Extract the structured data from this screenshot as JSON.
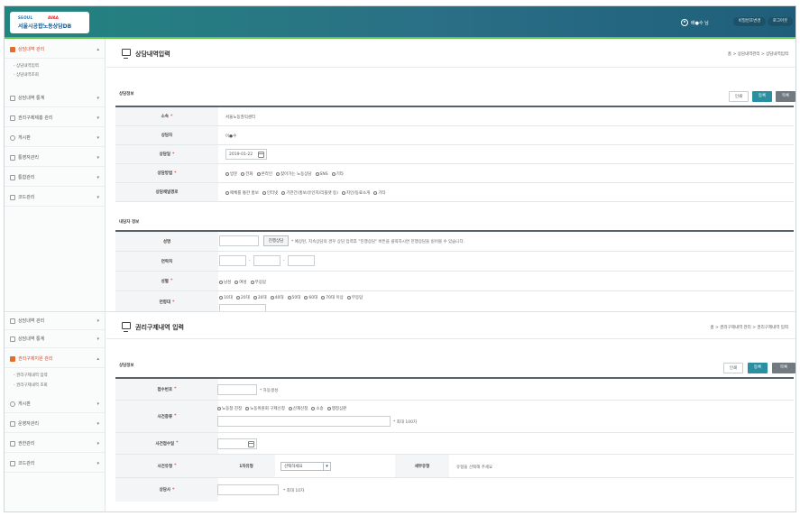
{
  "header": {
    "logo_top": "SEOUL",
    "logo_top_red": "AVAA",
    "logo_main": "서울시공합노동상담DB",
    "user_name": "배●수 님",
    "btn_info": "비밀번호변경",
    "btn_logout": "로그아웃"
  },
  "sidebar_top": {
    "items": [
      {
        "label": "상담내역 관리",
        "active": true
      },
      {
        "label": "상담내역 통계"
      },
      {
        "label": "권리구제제흥 관리"
      },
      {
        "label": "게시판"
      },
      {
        "label": "통영자관리"
      },
      {
        "label": "통합관리"
      },
      {
        "label": "코드관리"
      }
    ],
    "subs": [
      "- 상담내역입력",
      "- 상담내역조회"
    ]
  },
  "sidebar_bottom": {
    "items": [
      {
        "label": "상담내역 관리"
      },
      {
        "label": "상담내역 통계"
      },
      {
        "label": "권리구제지원 관리",
        "active": true
      },
      {
        "label": "게시판"
      },
      {
        "label": "운영자관리"
      },
      {
        "label": "권한관리"
      },
      {
        "label": "코드관리"
      }
    ],
    "subs": [
      "- 권리구제내역 입력",
      "- 권리구제내역 조회"
    ]
  },
  "consult": {
    "title": "상담내역입력",
    "breadcrumb": "홈 > 상담내역관리 > 상담내역입력",
    "section1": "상담정보",
    "buttons": [
      "인쇄",
      "등록",
      "목록"
    ],
    "rows": [
      {
        "label": "소속",
        "req": true,
        "value": "서울노동권익센터"
      },
      {
        "label": "상담자",
        "req": false,
        "value": "이●수"
      },
      {
        "label": "상담일",
        "req": true,
        "value": "2019-01-22"
      },
      {
        "label": "상담방법",
        "req": true,
        "options": [
          "방문",
          "전화",
          "온라인",
          "찾아가는 노동상담",
          "SNS",
          "기타"
        ]
      },
      {
        "label": "상담채널경로",
        "req": false,
        "options": [
          "매체를 통한 홍보",
          "인터넷",
          "기관간(홍보/유인지/리플렛 등)",
          "지인/동료소개",
          "기타"
        ]
      }
    ],
    "section2": "내담자 정보",
    "rows2": [
      {
        "label": "성명",
        "btn": "진행상담",
        "hint": "* 예상된, 지속상담의 경우 상담 입력후 \"진행상담\" 버튼을 클릭하시면 진행상담을 읽어볼 수 있습니다."
      },
      {
        "label": "연락처",
        "sep": "-"
      },
      {
        "label": "성별",
        "req": true,
        "options": [
          "남성",
          "여성",
          "무응답"
        ]
      },
      {
        "label": "연령대",
        "req": true,
        "options": [
          "10대",
          "20대",
          "30대",
          "40대",
          "50대",
          "60대",
          "70대 이상",
          "무응답"
        ]
      }
    ]
  },
  "relief": {
    "title": "권리구제내역 입력",
    "breadcrumb": "홈 > 권리구제내역 관리 > 권리구제내역 입력",
    "section1": "상담정보",
    "buttons": [
      "인쇄",
      "등록",
      "목록"
    ],
    "rows": [
      {
        "label": "접수번호",
        "req": true,
        "hint": "* 자동생성"
      },
      {
        "label": "사건종류",
        "req": true,
        "options": [
          "노동청 진정",
          "노동위원회 구제신청",
          "산재신청",
          "소송",
          "행정심판"
        ],
        "hint": "* 최대 100자"
      },
      {
        "label": "사건접수일",
        "req": true
      },
      {
        "label": "사건유형",
        "req": true,
        "sub_label": "1차유형",
        "select": "선택하세요",
        "sub_label2": "세부유형",
        "sub_hint": "유형을 선택해 주세요"
      },
      {
        "label": "상담사",
        "req": true,
        "hint": "* 최대 10자"
      }
    ]
  },
  "colors": {
    "top_bar": "#23857f",
    "accent_green": "#6bc24a",
    "teal_button": "#2a8fa0",
    "active_menu": "#d94b2b"
  }
}
